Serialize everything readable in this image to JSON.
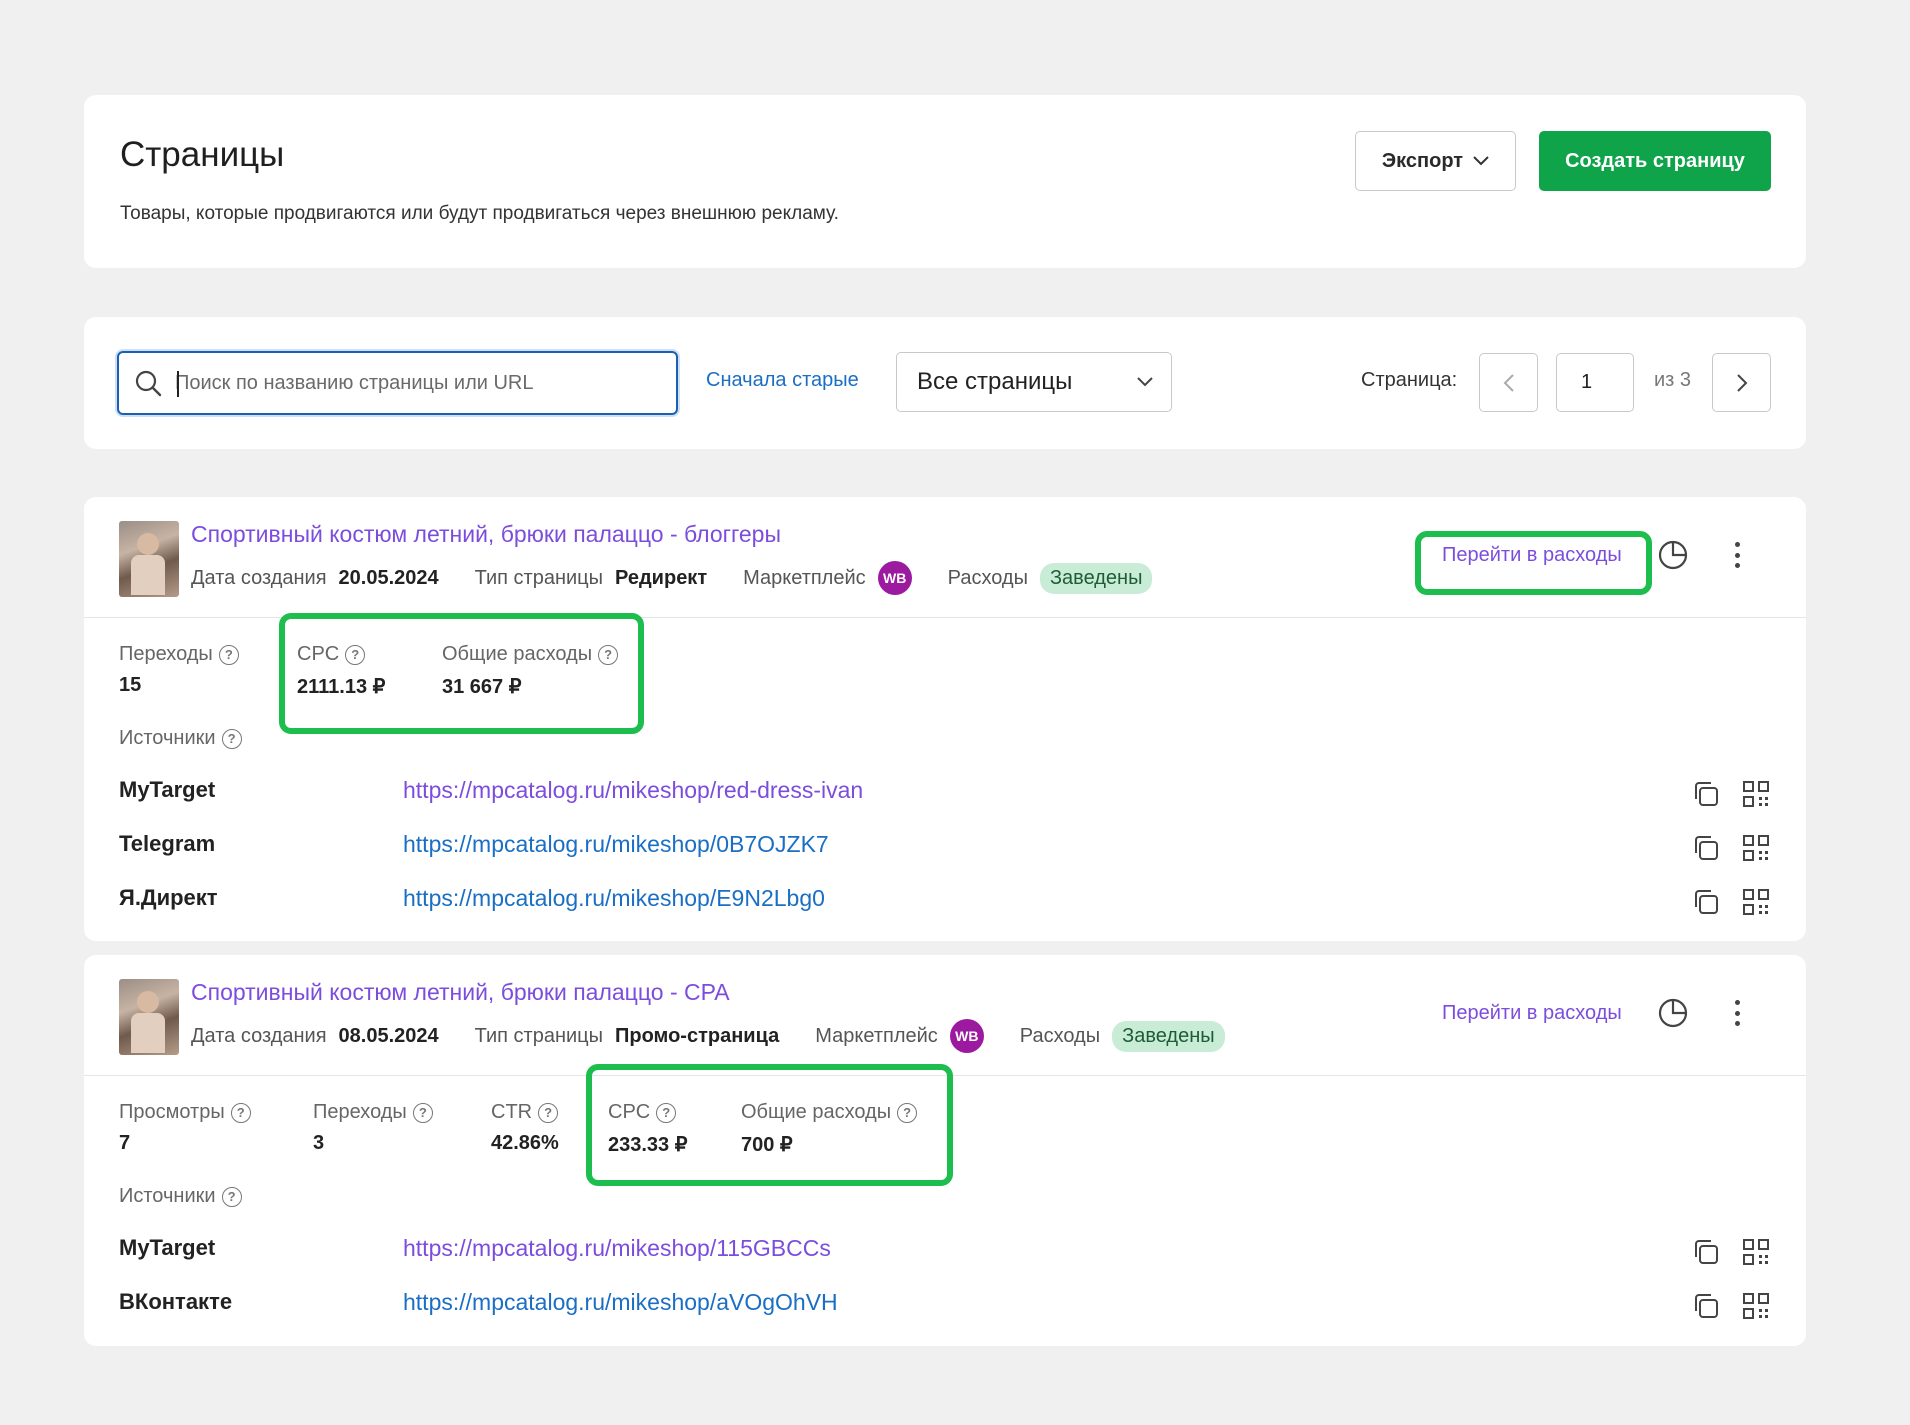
{
  "header": {
    "title": "Страницы",
    "subtitle": "Товары, которые продвигаются или будут продвигаться через внешнюю рекламу.",
    "export_label": "Экспорт",
    "create_label": "Создать страницу"
  },
  "filters": {
    "search_placeholder": "Поиск по названию страницы или URL",
    "sort_label": "Сначала старые",
    "select_value": "Все страницы",
    "page_label": "Страница:",
    "page_value": "1",
    "page_of": "из 3"
  },
  "pages": [
    {
      "title": "Спортивный костюм летний, брюки палаццо - блоггеры",
      "date_label": "Дата создания",
      "date": "20.05.2024",
      "type_label": "Тип страницы",
      "type": "Редирект",
      "marketplace_label": "Маркетплейс",
      "marketplace": "WB",
      "expenses_label": "Расходы",
      "expenses_status": "Заведены",
      "expenses_link": "Перейти в расходы",
      "stats": [
        {
          "label": "Переходы",
          "value": "15"
        },
        {
          "label": "CPC",
          "value": "2111.13 ₽"
        },
        {
          "label": "Общие расходы",
          "value": "31 667 ₽"
        }
      ],
      "sources_label": "Источники",
      "sources": [
        {
          "name": "MyTarget",
          "url": "https://mpcatalog.ru/mikeshop/red-dress-ivan"
        },
        {
          "name": "Telegram",
          "url": "https://mpcatalog.ru/mikeshop/0B7OJZK7"
        },
        {
          "name": "Я.Директ",
          "url": "https://mpcatalog.ru/mikeshop/E9N2Lbg0"
        }
      ]
    },
    {
      "title": "Спортивный костюм летний, брюки палаццо - CPA",
      "date_label": "Дата создания",
      "date": "08.05.2024",
      "type_label": "Тип страницы",
      "type": "Промо-страница",
      "marketplace_label": "Маркетплейс",
      "marketplace": "WB",
      "expenses_label": "Расходы",
      "expenses_status": "Заведены",
      "expenses_link": "Перейти в расходы",
      "stats": [
        {
          "label": "Просмотры",
          "value": "7"
        },
        {
          "label": "Переходы",
          "value": "3"
        },
        {
          "label": "CTR",
          "value": "42.86%"
        },
        {
          "label": "CPC",
          "value": "233.33 ₽"
        },
        {
          "label": "Общие расходы",
          "value": "700 ₽"
        }
      ],
      "sources_label": "Источники",
      "sources": [
        {
          "name": "MyTarget",
          "url": "https://mpcatalog.ru/mikeshop/115GBCCs"
        },
        {
          "name": "ВКонтакте",
          "url": "https://mpcatalog.ru/mikeshop/aVOgOhVH"
        }
      ]
    }
  ],
  "colors": {
    "accent_green": "#0fa34a",
    "highlight_green": "#1dbe4e",
    "link_blue": "#1a6fc4",
    "link_purple": "#7c4ddd",
    "wb_purple": "#9b1aa0"
  }
}
